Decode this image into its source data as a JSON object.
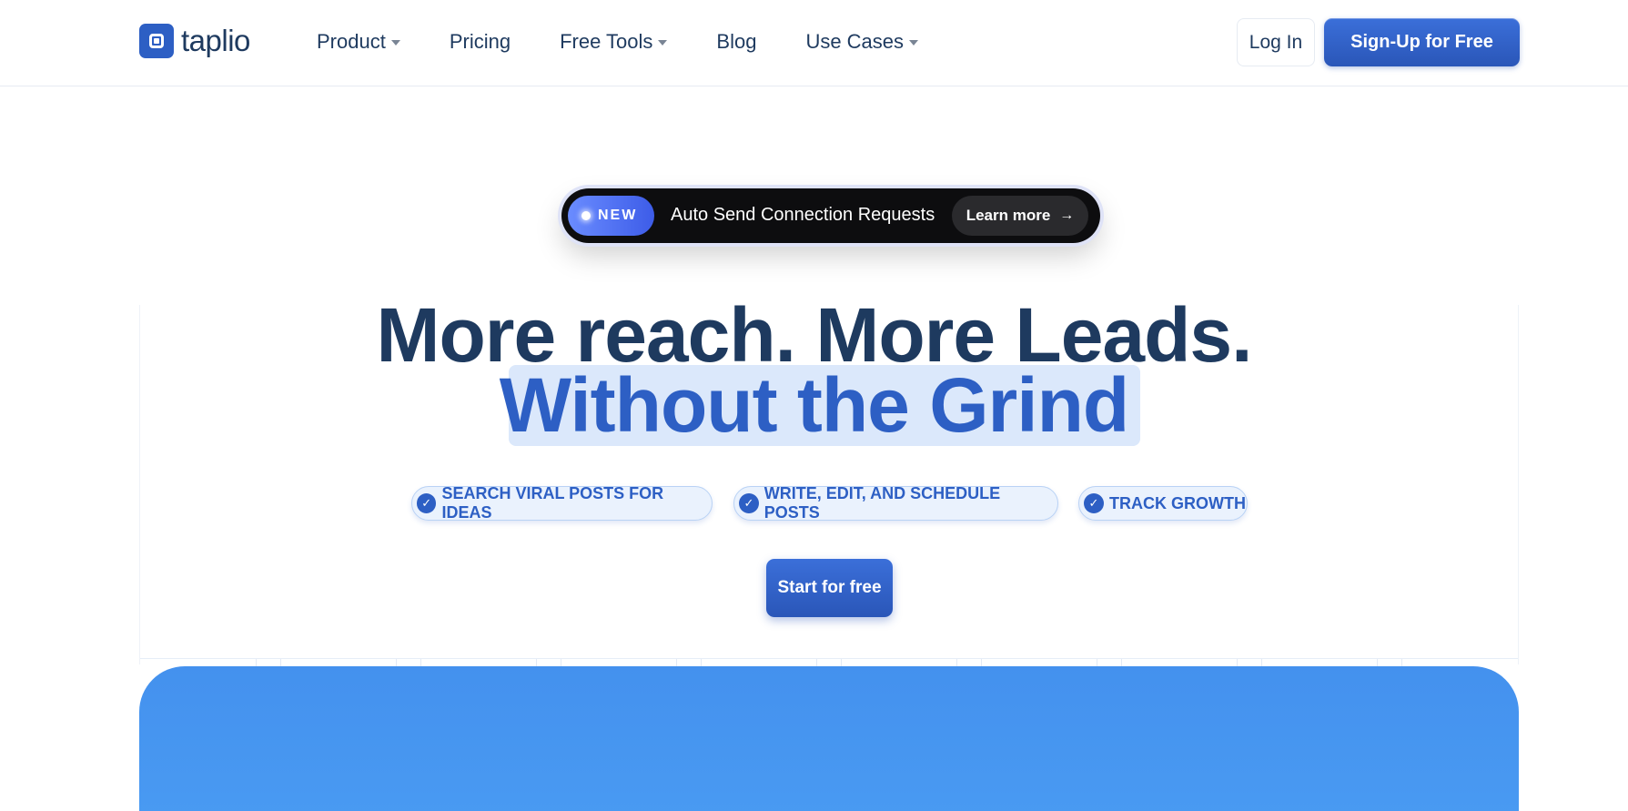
{
  "header": {
    "logo_text": "taplio",
    "nav": [
      {
        "label": "Product",
        "dropdown": true
      },
      {
        "label": "Pricing",
        "dropdown": false
      },
      {
        "label": "Free Tools",
        "dropdown": true
      },
      {
        "label": "Blog",
        "dropdown": false
      },
      {
        "label": "Use Cases",
        "dropdown": true
      }
    ],
    "login_label": "Log In",
    "signup_label": "Sign-Up for Free"
  },
  "announcement": {
    "badge": "NEW",
    "text": "Auto Send Connection Requests",
    "learn_more": "Learn more",
    "arrow": "→"
  },
  "hero": {
    "line1": "More reach. More Leads.",
    "line2": "Without the Grind"
  },
  "features": [
    {
      "label": "SEARCH VIRAL POSTS FOR IDEAS",
      "icon": "check-icon"
    },
    {
      "label": "WRITE, EDIT, AND SCHEDULE POSTS",
      "icon": "check-icon"
    },
    {
      "label": "TRACK GROWTH",
      "icon": "check-icon"
    }
  ],
  "cta_label": "Start for free",
  "colors": {
    "brand": "#2d5fc4",
    "text": "#1e3a5f",
    "highlight": "#dbe8fb",
    "panel": "#4491ee"
  }
}
